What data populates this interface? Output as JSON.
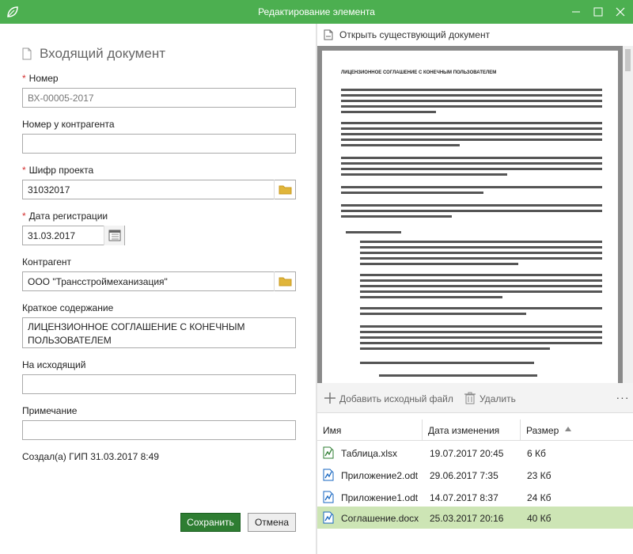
{
  "window": {
    "title": "Редактирование элемента"
  },
  "form": {
    "heading": "Входящий документ",
    "fields": {
      "number": {
        "label": "Номер",
        "required": true,
        "value": "ВХ-00005-2017"
      },
      "counterparty_number": {
        "label": "Номер у контрагента",
        "required": false,
        "value": ""
      },
      "project_code": {
        "label": "Шифр проекта",
        "required": true,
        "value": "31032017"
      },
      "registration_date": {
        "label": "Дата регистрации",
        "required": true,
        "value": "31.03.2017"
      },
      "counterparty": {
        "label": "Контрагент",
        "required": false,
        "value": "ООО \"Трансстроймеханизация\""
      },
      "summary": {
        "label": "Краткое содержание",
        "required": false,
        "value": "ЛИЦЕНЗИОННОЕ СОГЛАШЕНИЕ С КОНЕЧНЫМ ПОЛЬЗОВАТЕЛЕМ"
      },
      "outgoing": {
        "label": "На исходящий",
        "required": false,
        "value": ""
      },
      "note": {
        "label": "Примечание",
        "required": false,
        "value": ""
      }
    },
    "created": "Создал(а) ГИП 31.03.2017 8:49",
    "save_label": "Сохранить",
    "cancel_label": "Отмена"
  },
  "preview": {
    "open_label": "Открыть существующий документ",
    "page_heading": "ЛИЦЕНЗИОННОЕ СОГЛАШЕНИЕ С КОНЕЧНЫМ ПОЛЬЗОВАТЕЛЕМ"
  },
  "files": {
    "add_label": "Добавить исходный файл",
    "delete_label": "Удалить",
    "columns": {
      "name": "Имя",
      "modified": "Дата изменения",
      "size": "Размер"
    },
    "sort": {
      "column": "size",
      "direction": "ascending"
    },
    "rows": [
      {
        "name": "Таблица.xlsx",
        "modified": "19.07.2017 20:45",
        "size": "6 Кб",
        "selected": false
      },
      {
        "name": "Приложение2.odt",
        "modified": "29.06.2017 7:35",
        "size": "23 Кб",
        "selected": false
      },
      {
        "name": "Приложение1.odt",
        "modified": "14.07.2017 8:37",
        "size": "24 Кб",
        "selected": false
      },
      {
        "name": "Соглашение.docx",
        "modified": "25.03.2017 20:16",
        "size": "40 Кб",
        "selected": true
      }
    ]
  },
  "colors": {
    "accent": "#4caf50",
    "save_button": "#2e7d32",
    "selected_row": "#cde5b5",
    "required_mark": "#d32f2f"
  }
}
